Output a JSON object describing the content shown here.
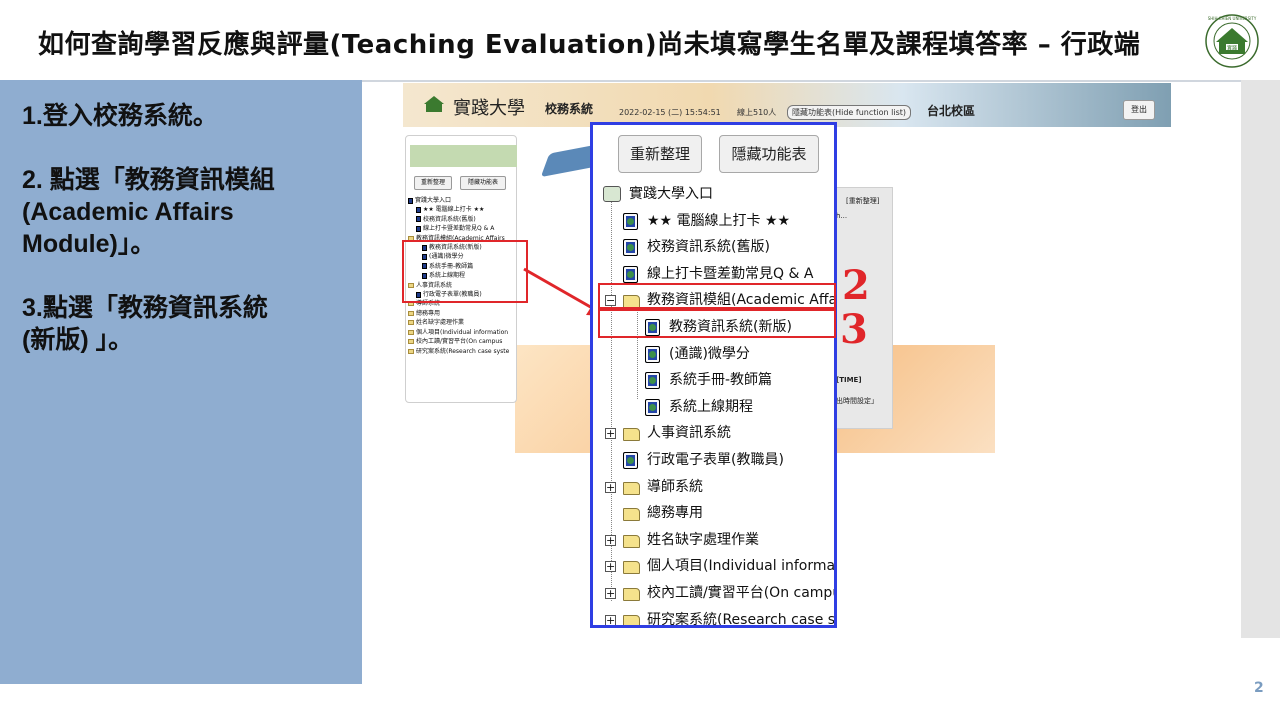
{
  "slide": {
    "title": "如何查詢學習反應與評量(Teaching Evaluation)尚未填寫學生名單及課程填答率 – 行政端",
    "page_number": "2",
    "logo_text": "實踐",
    "logo_ring_text": "SHIH CHIEN UNIVERSITY"
  },
  "steps": [
    "1.登入校務系統。",
    "2. 點選「教務資訊模組\n(Academic Affairs\nModule)」。",
    "3.點選「教務資訊系統\n(新版) 」。"
  ],
  "screenshot": {
    "school_name": "實踐大學",
    "system_name": "校務系統",
    "datetime": "2022-02-15 (二) 15:54:51",
    "online_users": "線上510人",
    "hide_function_button": "隱藏功能表(Hide function list)",
    "campus": "台北校區",
    "logout_button": "登出",
    "mini_sidebar": {
      "refresh_button": "重新整理",
      "hide_button": "隱藏功能表",
      "items": [
        "實踐大學入口",
        "★★ 電腦線上打卡 ★★",
        "校務資訊系統(舊版)",
        "線上打卡暨差勤常見Q & A",
        "教務資訊模組(Academic Affairs",
        "教務資訊系統(新版)",
        "(通識)微學分",
        "系統手冊-教師篇",
        "系統上線期程",
        "人事資訊系統",
        "行政電子表單(教職員)",
        "導師系統",
        "總務專用",
        "姓名缺字處理作業",
        "個人項目(Individual information",
        "校內工讀/實習平台(On campus",
        "研究案系統(Research case syste"
      ]
    },
    "right_panel": {
      "refresh_label": "[重新整理]",
      "ellipsis": "h...",
      "time_label": "[TIME]",
      "time_setting": "出時間設定」"
    }
  },
  "zoomed_menu": {
    "refresh_button": "重新整理",
    "hide_button": "隱藏功能表",
    "root": "實踐大學入口",
    "items": [
      {
        "label": "★★ 電腦線上打卡 ★★",
        "type": "doc",
        "level": 1
      },
      {
        "label": "校務資訊系統(舊版)",
        "type": "doc",
        "level": 1
      },
      {
        "label": "線上打卡暨差勤常見Q & A",
        "type": "doc",
        "level": 1
      },
      {
        "label": "教務資訊模組(Academic Affairs",
        "type": "folder-open",
        "level": 1
      },
      {
        "label": "教務資訊系統(新版)",
        "type": "doc",
        "level": 2
      },
      {
        "label": "(通識)微學分",
        "type": "doc",
        "level": 2
      },
      {
        "label": "系統手冊-教師篇",
        "type": "doc",
        "level": 2
      },
      {
        "label": "系統上線期程",
        "type": "doc",
        "level": 2
      },
      {
        "label": "人事資訊系統",
        "type": "folder",
        "level": 1
      },
      {
        "label": "行政電子表單(教職員)",
        "type": "doc",
        "level": 1
      },
      {
        "label": "導師系統",
        "type": "folder",
        "level": 1
      },
      {
        "label": "總務專用",
        "type": "folder-noplus",
        "level": 1
      },
      {
        "label": "姓名缺字處理作業",
        "type": "folder",
        "level": 1
      },
      {
        "label": "個人項目(Individual information",
        "type": "folder",
        "level": 1
      },
      {
        "label": "校內工讀/實習平台(On campus",
        "type": "folder",
        "level": 1
      },
      {
        "label": "研究案系統(Research case syste",
        "type": "folder",
        "level": 1
      }
    ]
  },
  "annotations": {
    "step2_number": "2",
    "step3_number": "3",
    "highlight_color": "#e0262a",
    "zoom_border_color": "#2f3ee3"
  }
}
